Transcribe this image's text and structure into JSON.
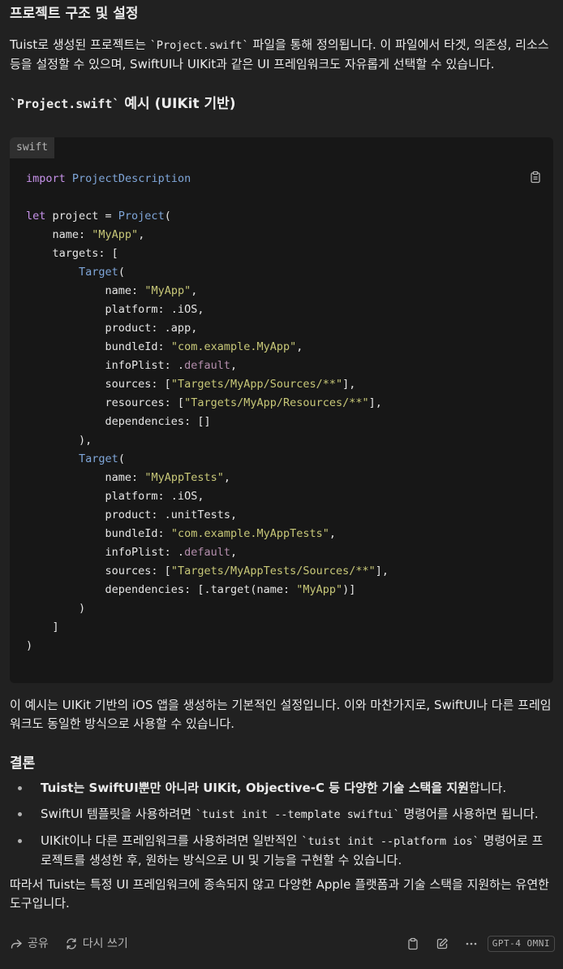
{
  "section1": {
    "title": "프로젝트 구조 및 설정",
    "para_prefix": "Tuist로 생성된 프로젝트는 ",
    "para_code": "`Project.swift`",
    "para_suffix": " 파일을 통해 정의됩니다. 이 파일에서 타겟, 의존성, 리소스 등을 설정할 수 있으며, SwiftUI나 UIKit과 같은 UI 프레임워크도 자유롭게 선택할 수 있습니다."
  },
  "example": {
    "title_code": "`Project.swift`",
    "title_text": " 예시 (UIKit 기반)"
  },
  "code": {
    "language": "swift",
    "copy_icon": "clipboard-icon"
  },
  "summary_para": "이 예시는 UIKit 기반의 iOS 앱을 생성하는 기본적인 설정입니다. 이와 마찬가지로, SwiftUI나 다른 프레임워크도 동일한 방식으로 사용할 수 있습니다.",
  "conclusion": {
    "title": "결론",
    "b1_bold": "Tuist는 SwiftUI뿐만 아니라 UIKit, Objective-C 등 다양한 기술 스택을 지원",
    "b1_rest": "합니다.",
    "b2_prefix": "SwiftUI 템플릿을 사용하려면 ",
    "b2_code": "`tuist init --template swiftui`",
    "b2_suffix": " 명령어를 사용하면 됩니다.",
    "b3_prefix": "UIKit이나 다른 프레임워크를 사용하려면 일반적인 ",
    "b3_code": "`tuist init --platform ios`",
    "b3_suffix": " 명령어로 프로젝트를 생성한 후, 원하는 방식으로 UI 및 기능을 구현할 수 있습니다.",
    "final": "따라서 Tuist는 특정 UI 프레임워크에 종속되지 않고 다양한 Apple 플랫폼과 기술 스택을 지원하는 유연한 도구입니다."
  },
  "footer": {
    "share_label": "공유",
    "rewrite_label": "다시 쓰기",
    "model_badge": "GPT-4 OMNI"
  }
}
